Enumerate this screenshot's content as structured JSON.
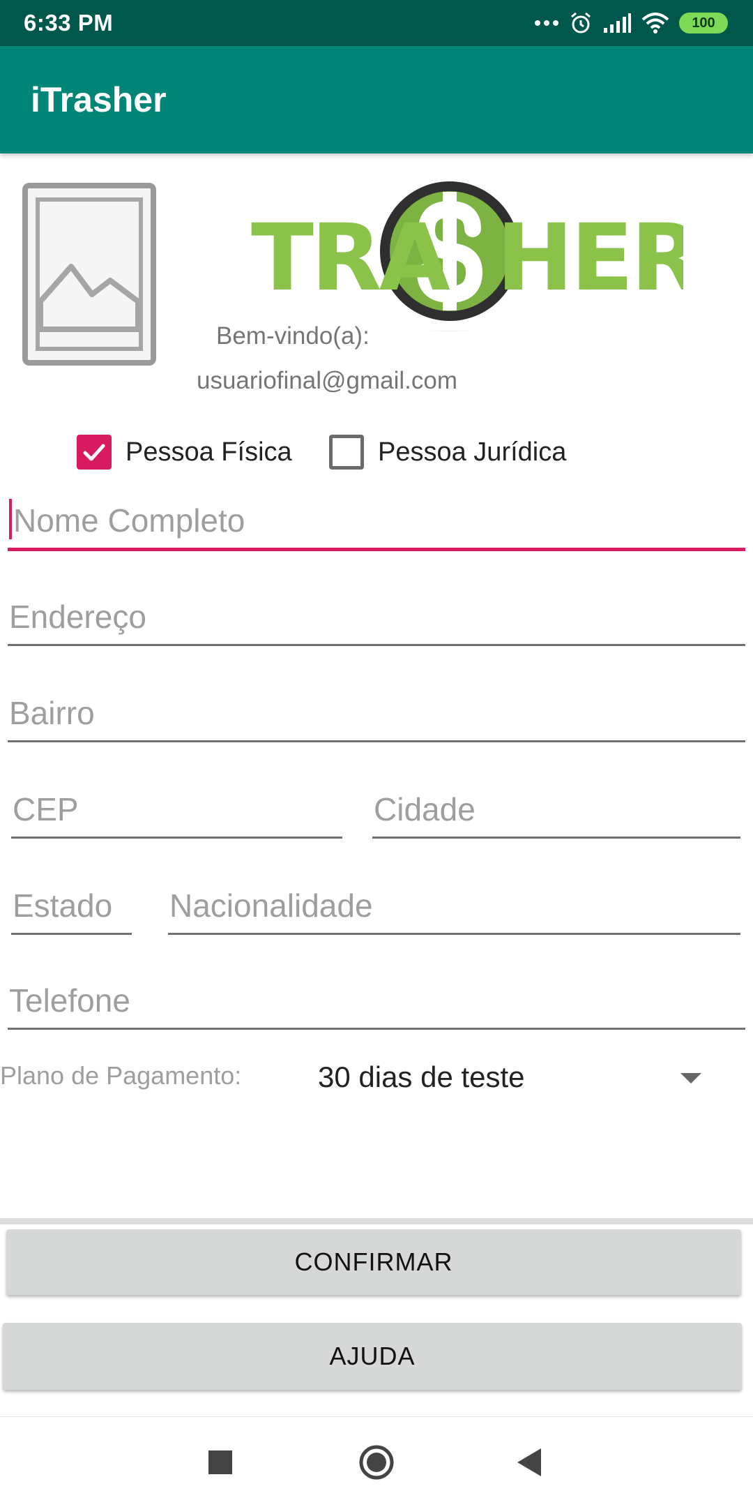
{
  "status_bar": {
    "time": "6:33 PM",
    "battery": "100",
    "icons": [
      "more-dots-icon",
      "alarm-icon",
      "signal-icon",
      "wifi-icon",
      "battery-icon"
    ]
  },
  "app_bar": {
    "title": "iTrasher"
  },
  "header": {
    "logo_text": "TRA$HER",
    "welcome": "Bem-vindo(a):",
    "email": "usuariofinal@gmail.com"
  },
  "person_type": {
    "fisica_label": "Pessoa Física",
    "fisica_checked": true,
    "juridica_label": "Pessoa Jurídica",
    "juridica_checked": false
  },
  "form": {
    "nome_placeholder": "Nome Completo",
    "endereco_placeholder": "Endereço",
    "bairro_placeholder": "Bairro",
    "cep_placeholder": "CEP",
    "cidade_placeholder": "Cidade",
    "estado_placeholder": "Estado",
    "nacionalidade_placeholder": "Nacionalidade",
    "telefone_placeholder": "Telefone"
  },
  "plan": {
    "label": "Plano de Pagamento:",
    "selected": "30 dias de teste"
  },
  "buttons": {
    "confirm": "CONFIRMAR",
    "help": "AJUDA"
  },
  "colors": {
    "primary": "#008577",
    "primary_dark": "#00574b",
    "accent": "#d81b60",
    "logo_green": "#8bc34a"
  }
}
